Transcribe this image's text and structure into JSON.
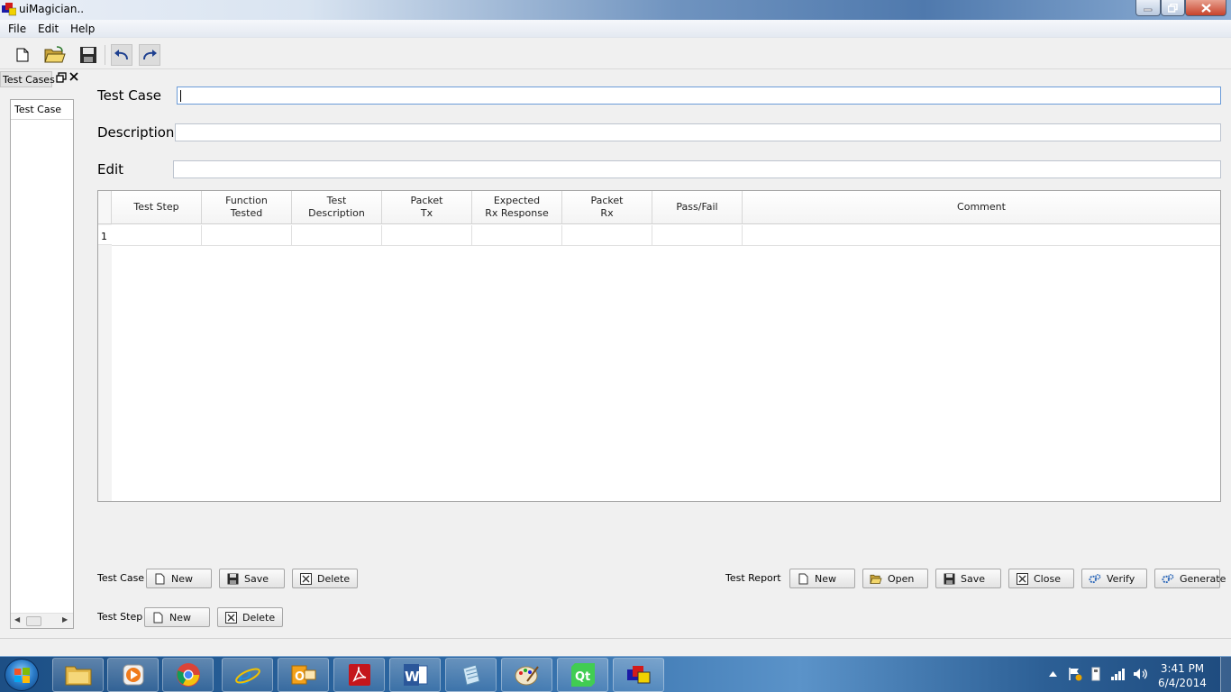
{
  "window": {
    "title": "uiMagician.."
  },
  "menu": {
    "file": "File",
    "edit": "Edit",
    "help": "Help"
  },
  "dock": {
    "title": "Test Cases",
    "tree_header": "Test Case"
  },
  "form": {
    "test_case_label": "Test Case",
    "description_label": "Description",
    "edit_label": "Edit",
    "test_case_value": "",
    "description_value": "",
    "edit_value": ""
  },
  "table": {
    "columns": [
      "Test Step",
      "Function\nTested",
      "Test\nDescription",
      "Packet\nTx",
      "Expected\nRx Response",
      "Packet\nRx",
      "Pass/Fail",
      "Comment"
    ],
    "rows": [
      {
        "number": "1",
        "cells": [
          "",
          "",
          "",
          "",
          "",
          "",
          "",
          ""
        ]
      }
    ]
  },
  "test_case_actions": {
    "label": "Test Case",
    "new": "New",
    "save": "Save",
    "delete": "Delete"
  },
  "test_step_actions": {
    "label": "Test Step",
    "new": "New",
    "delete": "Delete"
  },
  "test_report_actions": {
    "label": "Test  Report",
    "new": "New",
    "open": "Open",
    "save": "Save",
    "close": "Close",
    "verify": "Verify",
    "generate": "Generate"
  },
  "taskbar": {
    "items": [
      "explorer-icon",
      "media-player-icon",
      "chrome-icon",
      "internet-explorer-icon",
      "outlook-icon",
      "acrobat-icon",
      "word-icon",
      "notepad-icon",
      "paint-icon",
      "qt-icon",
      "uimagician-icon"
    ],
    "clock_time": "3:41 PM",
    "clock_date": "6/4/2014"
  }
}
